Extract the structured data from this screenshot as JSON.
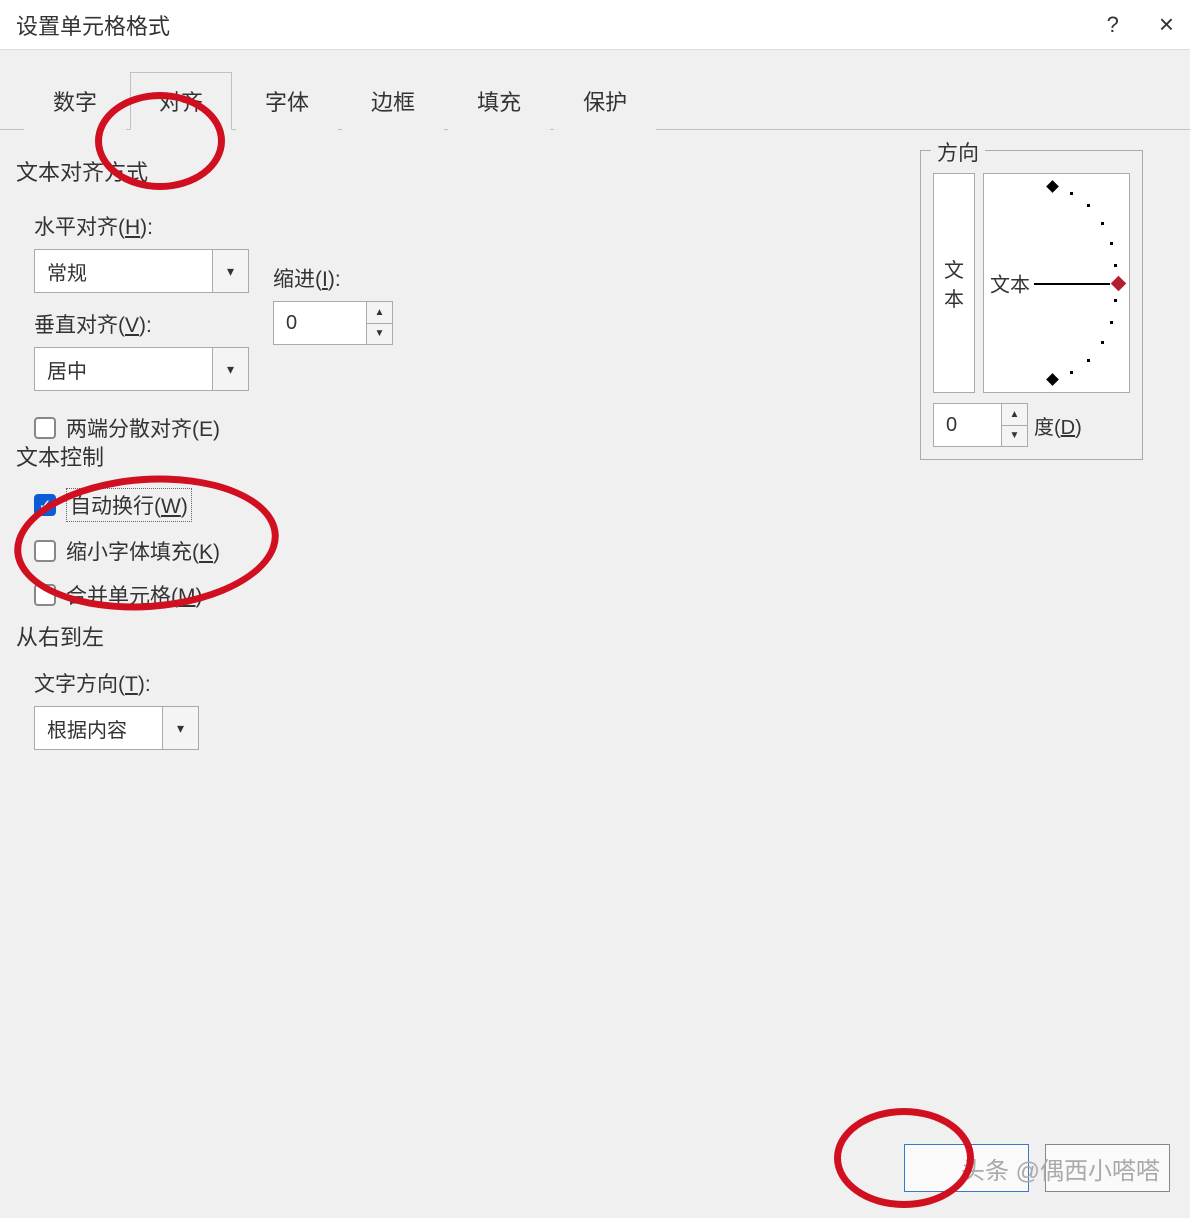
{
  "title": "设置单元格格式",
  "titlebar": {
    "help": "?",
    "close": "×"
  },
  "tabs": [
    "数字",
    "对齐",
    "字体",
    "边框",
    "填充",
    "保护"
  ],
  "active_tab": "对齐",
  "align": {
    "group_label": "文本对齐方式",
    "h_label": "水平对齐(H):",
    "h_value": "常规",
    "v_label": "垂直对齐(V):",
    "v_value": "居中",
    "indent_label": "缩进(I):",
    "indent_value": "0",
    "justify_label": "两端分散对齐(E)"
  },
  "control": {
    "group_label": "文本控制",
    "wrap_label": "自动换行(W)",
    "shrink_label": "缩小字体填充(K)",
    "merge_label": "合并单元格(M)"
  },
  "rtl": {
    "group_label": "从右到左",
    "dir_label": "文字方向(T):",
    "dir_value": "根据内容"
  },
  "orient": {
    "group_label": "方向",
    "v_text_1": "文",
    "v_text_2": "本",
    "arc_text": "文本",
    "deg_value": "0",
    "deg_label": "度(D)"
  },
  "buttons": {
    "ok": " ",
    "cancel": " "
  },
  "watermark": "头条 @偶西小嗒嗒"
}
